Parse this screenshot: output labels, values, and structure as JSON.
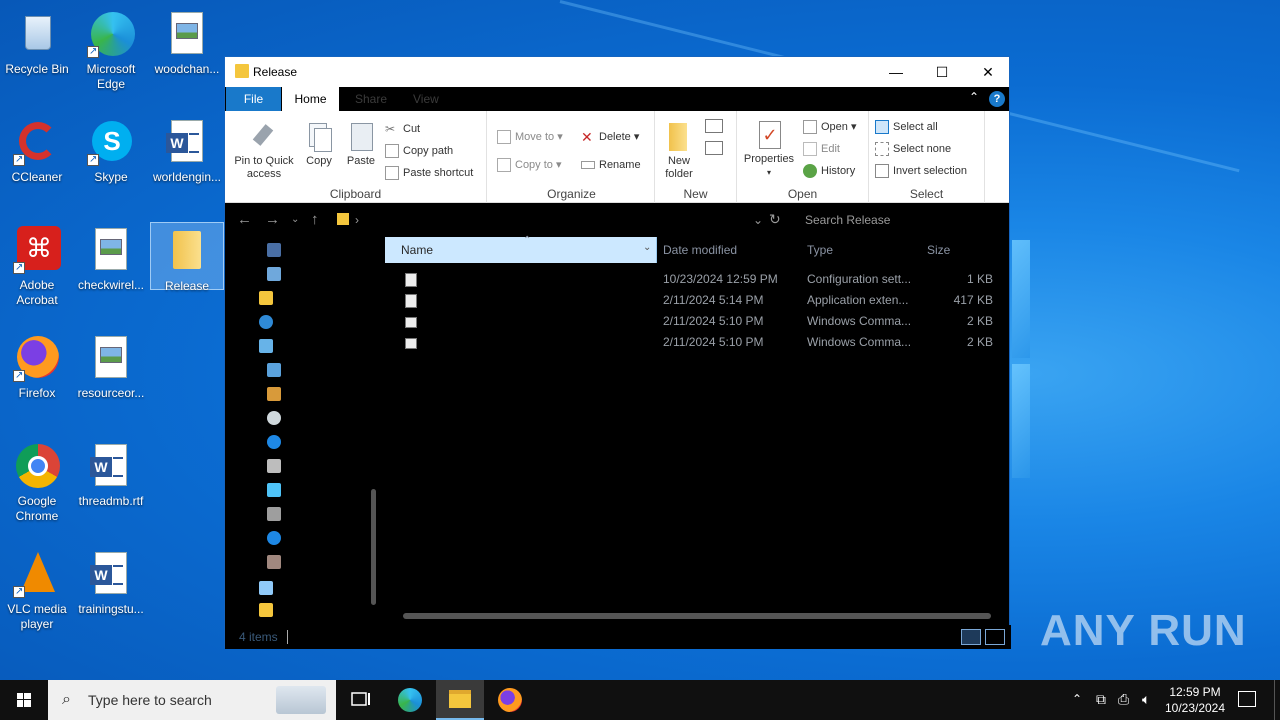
{
  "desktop": {
    "icons": [
      {
        "label": "Recycle Bin"
      },
      {
        "label": "Microsoft Edge"
      },
      {
        "label": "woodchan..."
      },
      {
        "label": "CCleaner"
      },
      {
        "label": "Skype"
      },
      {
        "label": "worldengin..."
      },
      {
        "label": "Adobe Acrobat"
      },
      {
        "label": "checkwirel..."
      },
      {
        "label": "Release"
      },
      {
        "label": "Firefox"
      },
      {
        "label": "resourceor..."
      },
      {
        "label": "Google Chrome"
      },
      {
        "label": "threadmb.rtf"
      },
      {
        "label": "VLC media player"
      },
      {
        "label": "trainingstu..."
      }
    ]
  },
  "window": {
    "title": "Release",
    "controls": {
      "minimize": "—",
      "maximize": "☐",
      "close": "✕"
    },
    "tabs": {
      "file": "File",
      "home": "Home",
      "share": "Share",
      "view": "View"
    },
    "ribbon": {
      "clipboard": {
        "pin": "Pin to Quick access",
        "copy": "Copy",
        "paste": "Paste",
        "cut": "Cut",
        "copy_path": "Copy path",
        "paste_shortcut": "Paste shortcut",
        "label": "Clipboard"
      },
      "organize": {
        "move_to": "Move to",
        "copy_to": "Copy to",
        "delete": "Delete",
        "rename": "Rename",
        "label": "Organize"
      },
      "new": {
        "new_folder": "New folder",
        "label": "New"
      },
      "open": {
        "properties": "Properties",
        "open": "Open",
        "edit": "Edit",
        "history": "History",
        "label": "Open"
      },
      "select": {
        "select_all": "Select all",
        "select_none": "Select none",
        "invert": "Invert selection",
        "label": "Select"
      }
    },
    "search_placeholder": "Search Release",
    "columns": {
      "name": "Name",
      "date": "Date modified",
      "type": "Type",
      "size": "Size"
    },
    "files": [
      {
        "date": "10/23/2024 12:59 PM",
        "type": "Configuration sett...",
        "size": "1 KB"
      },
      {
        "date": "2/11/2024 5:14 PM",
        "type": "Application exten...",
        "size": "417 KB"
      },
      {
        "date": "2/11/2024 5:10 PM",
        "type": "Windows Comma...",
        "size": "2 KB"
      },
      {
        "date": "2/11/2024 5:10 PM",
        "type": "Windows Comma...",
        "size": "2 KB"
      }
    ],
    "status": "4 items"
  },
  "taskbar": {
    "search_placeholder": "Type here to search",
    "time": "12:59 PM",
    "date": "10/23/2024"
  },
  "watermark": "ANY RUN",
  "colors": {
    "accent": "#1979ca",
    "selection": "#cce8ff",
    "folder": "#f4c63d"
  }
}
